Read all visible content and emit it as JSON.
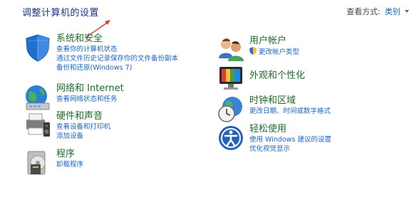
{
  "header": {
    "title": "调整计算机的设置",
    "view_by_label": "查看方式:",
    "view_by_value": "类别"
  },
  "categories": {
    "system_security": {
      "title": "系统和安全",
      "links": [
        "查看你的计算机状态",
        "通过文件历史记录保存你的文件备份副本",
        "备份和还原(Windows 7)"
      ]
    },
    "network": {
      "title": "网络和 Internet",
      "links": [
        "查看网络状态和任务"
      ]
    },
    "hardware": {
      "title": "硬件和声音",
      "links": [
        "查看设备和打印机",
        "添加设备"
      ]
    },
    "programs": {
      "title": "程序",
      "links": [
        "卸载程序"
      ]
    },
    "user_accounts": {
      "title": "用户帐户",
      "links": [
        "更改帐户类型"
      ]
    },
    "appearance": {
      "title": "外观和个性化",
      "links": []
    },
    "clock_region": {
      "title": "时钟和区域",
      "links": [
        "更改日期、时间或数字格式"
      ]
    },
    "ease_access": {
      "title": "轻松使用",
      "links": [
        "使用 Windows 建议的设置",
        "优化视觉显示"
      ]
    }
  },
  "colors": {
    "title_blue": "#1e3287",
    "category_green": "#1b6b2b",
    "link_blue": "#1a66c9",
    "arrow_red": "#e53935"
  },
  "icons": {
    "system_security": "shield-icon",
    "network": "globe-network-icon",
    "hardware": "printer-speaker-icon",
    "programs": "programs-disk-icon",
    "user_accounts": "users-icon",
    "appearance": "monitor-colors-icon",
    "clock_region": "clock-globe-icon",
    "ease_access": "ease-access-icon"
  }
}
